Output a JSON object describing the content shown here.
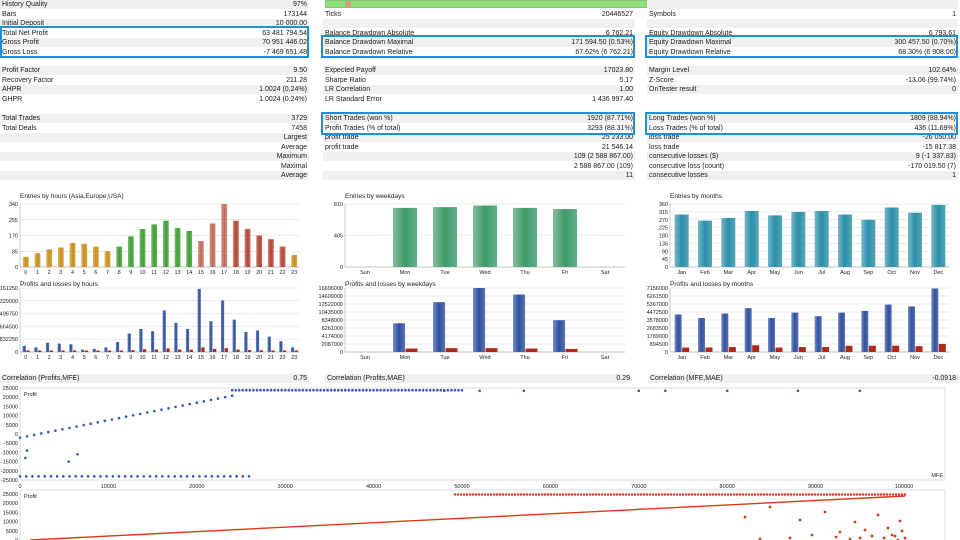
{
  "stats": {
    "col1_top": [
      {
        "label": "History Quality",
        "value": "97%"
      },
      {
        "label": "Bars",
        "value": "173144"
      },
      {
        "label": "Initial Deposit",
        "value": "10 000.00"
      },
      {
        "label": "Total Net Profit",
        "value": "63 481 794.54"
      },
      {
        "label": "Gross Profit",
        "value": "70 951 446.02"
      },
      {
        "label": "Gross Loss",
        "value": "-7 469 651.48"
      }
    ],
    "col2_top": [
      {
        "label": "",
        "value": ""
      },
      {
        "label": "Ticks",
        "value": "20446527"
      },
      {
        "label": "",
        "value": ""
      },
      {
        "label": "Balance Drawdown Absolute",
        "value": "6 762.21"
      },
      {
        "label": "Balance Drawdown Maximal",
        "value": "171 594.50 (0.53%)"
      },
      {
        "label": "Balance Drawdown Relative",
        "value": "67.62% (6 762.21)"
      }
    ],
    "col3_top": [
      {
        "label": "",
        "value": ""
      },
      {
        "label": "Symbols",
        "value": "1"
      },
      {
        "label": "",
        "value": ""
      },
      {
        "label": "Equity Drawdown Absolute",
        "value": "6 793.61"
      },
      {
        "label": "Equity Drawdown Maximal",
        "value": "300 457.50 (0.70%)"
      },
      {
        "label": "Equity Drawdown Relative",
        "value": "68.30% (6 908.00)"
      }
    ],
    "col1_mid": [
      {
        "label": "Profit Factor",
        "value": "9.50"
      },
      {
        "label": "Recovery Factor",
        "value": "211.28"
      },
      {
        "label": "AHPR",
        "value": "1.0024 (0.24%)"
      },
      {
        "label": "GHPR",
        "value": "1.0024 (0.24%)"
      }
    ],
    "col2_mid": [
      {
        "label": "Expected Payoff",
        "value": "17023.80"
      },
      {
        "label": "Sharpe Ratio",
        "value": "5.17"
      },
      {
        "label": "LR Correlation",
        "value": "1.00"
      },
      {
        "label": "LR Standard Error",
        "value": "1 436 997.40"
      }
    ],
    "col3_mid": [
      {
        "label": "Margin Level",
        "value": "102.64%"
      },
      {
        "label": "Z-Score",
        "value": "-13.06 (99.74%)"
      },
      {
        "label": "OnTester result",
        "value": "0"
      },
      {
        "label": "",
        "value": ""
      }
    ],
    "col1_bot": [
      {
        "label": "Total Trades",
        "value": "3729"
      },
      {
        "label": "Total Deals",
        "value": "7458"
      },
      {
        "label": "",
        "value": "Largest"
      },
      {
        "label": "",
        "value": "Average"
      },
      {
        "label": "",
        "value": "Maximum"
      },
      {
        "label": "",
        "value": "Maximal"
      },
      {
        "label": "",
        "value": "Average"
      }
    ],
    "col2_bot": [
      {
        "label": "Short Trades (won %)",
        "value": "1920 (87.71%)"
      },
      {
        "label": "Profit Trades (% of total)",
        "value": "3293 (88.31%)"
      },
      {
        "label": "profit trade",
        "value": "25 233.00"
      },
      {
        "label": "profit trade",
        "value": "21 546.14"
      },
      {
        "label": "",
        "value": "109 (2 588 867.00)"
      },
      {
        "label": "",
        "value": "2 588 867.00 (109)"
      },
      {
        "label": "",
        "value": "11"
      }
    ],
    "col3_bot": [
      {
        "label": "Long Trades (won %)",
        "value": "1809 (88.94%)"
      },
      {
        "label": "Loss Trades (% of total)",
        "value": "436 (11.69%)"
      },
      {
        "label": "loss trade",
        "value": "-26 050.00"
      },
      {
        "label": "loss trade",
        "value": "-15 817.38"
      },
      {
        "label": "consecutive losses ($)",
        "value": "9 (-1 337.83)"
      },
      {
        "label": "consecutive loss (count)",
        "value": "-170 019.50 (7)"
      },
      {
        "label": "consecutive losses",
        "value": "1"
      }
    ]
  },
  "colors": {
    "accent_box": "#1f8fd6",
    "weekday_bar": "#3f9a68",
    "month_bar": "#2a8fa8",
    "profit_bar": "#2f4fa0",
    "loss_bar": "#b02818",
    "mfe_dots": "#2f58b8",
    "mae_dots": "#d83a1a",
    "quality_bar": "#8fe07a"
  },
  "chart_data": [
    {
      "type": "bar",
      "title": "Entries by hours (Asia,Europe,USA)",
      "categories": [
        "0",
        "1",
        "2",
        "3",
        "4",
        "5",
        "6",
        "7",
        "8",
        "9",
        "10",
        "11",
        "12",
        "13",
        "14",
        "15",
        "16",
        "17",
        "18",
        "19",
        "20",
        "21",
        "22",
        "23"
      ],
      "values": [
        55,
        75,
        95,
        105,
        130,
        125,
        110,
        85,
        110,
        165,
        205,
        230,
        250,
        210,
        195,
        140,
        235,
        340,
        250,
        205,
        170,
        150,
        110,
        65
      ],
      "yticks": [
        "0",
        "85",
        "170",
        "255",
        "340"
      ],
      "ylim": [
        0,
        340
      ],
      "colors_by_hour": [
        "#c9901a",
        "#c9901a",
        "#c9901a",
        "#c9901a",
        "#c9901a",
        "#c9901a",
        "#c9901a",
        "#c9901a",
        "#3e9e32",
        "#3e9e32",
        "#3e9e32",
        "#3e9e32",
        "#3e9e32",
        "#3e9e32",
        "#3e9e32",
        "#c06a5a",
        "#c06a5a",
        "#c06a5a",
        "#b44535",
        "#b44535",
        "#b44535",
        "#b44535",
        "#b44535",
        "#c9901a"
      ]
    },
    {
      "type": "bar",
      "title": "Entries by weekdays",
      "categories": [
        "Sun",
        "Mon",
        "Tue",
        "Wed",
        "Thu",
        "Fri",
        "Sat"
      ],
      "values": [
        0,
        760,
        770,
        790,
        760,
        745,
        0
      ],
      "yticks": [
        "0",
        "405",
        "810"
      ],
      "ylim": [
        0,
        810
      ]
    },
    {
      "type": "bar",
      "title": "Entries by months",
      "categories": [
        "Jan",
        "Feb",
        "Mar",
        "Apr",
        "May",
        "Jun",
        "Jul",
        "Aug",
        "Sep",
        "Oct",
        "Nov",
        "Dec"
      ],
      "values": [
        300,
        265,
        280,
        320,
        295,
        315,
        320,
        300,
        270,
        340,
        310,
        355
      ],
      "yticks": [
        "0",
        "45",
        "90",
        "135",
        "180",
        "225",
        "270",
        "315",
        "360"
      ],
      "ylim": [
        0,
        360
      ]
    },
    {
      "type": "bar",
      "title": "Profits and losses by hours",
      "categories": [
        "0",
        "1",
        "2",
        "3",
        "4",
        "5",
        "6",
        "7",
        "8",
        "9",
        "10",
        "11",
        "12",
        "13",
        "14",
        "15",
        "16",
        "17",
        "18",
        "19",
        "20",
        "21",
        "22",
        "23"
      ],
      "series": [
        {
          "name": "",
          "values": [
            400000,
            300000,
            600000,
            550000,
            500000,
            150000,
            200000,
            300000,
            650000,
            1200000,
            1500000,
            1350000,
            2700000,
            1900000,
            1500000,
            4100000,
            2000000,
            3350000,
            2100000,
            1300000,
            1400000,
            1000000,
            700000,
            300000
          ]
        },
        {
          "name": "",
          "values": [
            50000,
            50000,
            50000,
            50000,
            50000,
            30000,
            40000,
            60000,
            100000,
            120000,
            180000,
            160000,
            230000,
            160000,
            150000,
            300000,
            200000,
            250000,
            160000,
            120000,
            110000,
            90000,
            60000,
            40000
          ]
        }
      ],
      "yticks": [
        "0",
        "832250",
        "1664500",
        "2496750",
        "3329000",
        "4161250"
      ],
      "ylim": [
        0,
        4161250
      ]
    },
    {
      "type": "bar",
      "title": "Profits and losses by weekdays",
      "categories": [
        "Sun",
        "Mon",
        "Tue",
        "Wed",
        "Thu",
        "Fri",
        "Sat"
      ],
      "series": [
        {
          "name": "",
          "values": [
            0,
            7500000,
            13000000,
            16700000,
            15000000,
            8300000,
            0
          ]
        },
        {
          "name": "",
          "values": [
            0,
            900000,
            1000000,
            1000000,
            900000,
            800000,
            0
          ]
        }
      ],
      "yticks": [
        "0",
        "2087000",
        "4174000",
        "6261000",
        "8348000",
        "10435000",
        "12522000",
        "14609000",
        "16696000"
      ],
      "ylim": [
        0,
        16696000
      ]
    },
    {
      "type": "bar",
      "title": "Profits and losses by months",
      "categories": [
        "Jan",
        "Feb",
        "Mar",
        "Apr",
        "May",
        "Jun",
        "Jul",
        "Aug",
        "Sep",
        "Oct",
        "Nov",
        "Dec"
      ],
      "series": [
        {
          "name": "",
          "values": [
            4200000,
            3800000,
            4300000,
            4900000,
            3800000,
            4400000,
            4000000,
            4400000,
            4600000,
            5300000,
            5100000,
            7100000
          ]
        },
        {
          "name": "",
          "values": [
            500000,
            500000,
            550000,
            750000,
            500000,
            550000,
            550000,
            700000,
            700000,
            700000,
            650000,
            900000
          ]
        }
      ],
      "yticks": [
        "0",
        "894500",
        "1789000",
        "2683500",
        "3578000",
        "4472500",
        "5367000",
        "6261500",
        "7156000"
      ],
      "ylim": [
        0,
        7156000
      ]
    },
    {
      "type": "scatter",
      "title": "Correlation (Profits,MFE)",
      "value": "0.75",
      "ylabel": "Profit",
      "xlabel": "MFE",
      "xticks": [
        "0",
        "10000",
        "20000",
        "30000",
        "40000",
        "50000",
        "60000",
        "70000",
        "80000",
        "90000",
        "100000"
      ],
      "yticks": [
        "25000",
        "20000",
        "15000",
        "10000",
        "5000",
        "0",
        "-5000",
        "-10000",
        "-15000",
        "-20000",
        "-25000"
      ],
      "xlim": [
        0,
        100000
      ],
      "ylim": [
        -25000,
        25000
      ]
    },
    {
      "type": "scatter",
      "title": "Correlation (Profits,MAE)",
      "value": "0.29",
      "ylabel": "Profit",
      "yticks": [
        "25000",
        "20000",
        "15000",
        "10000",
        "5000",
        "0"
      ],
      "ylim": [
        0,
        25000
      ]
    },
    {
      "type": "scatter",
      "title": "Correlation (MFE,MAE)",
      "value": "-0.0918"
    }
  ]
}
